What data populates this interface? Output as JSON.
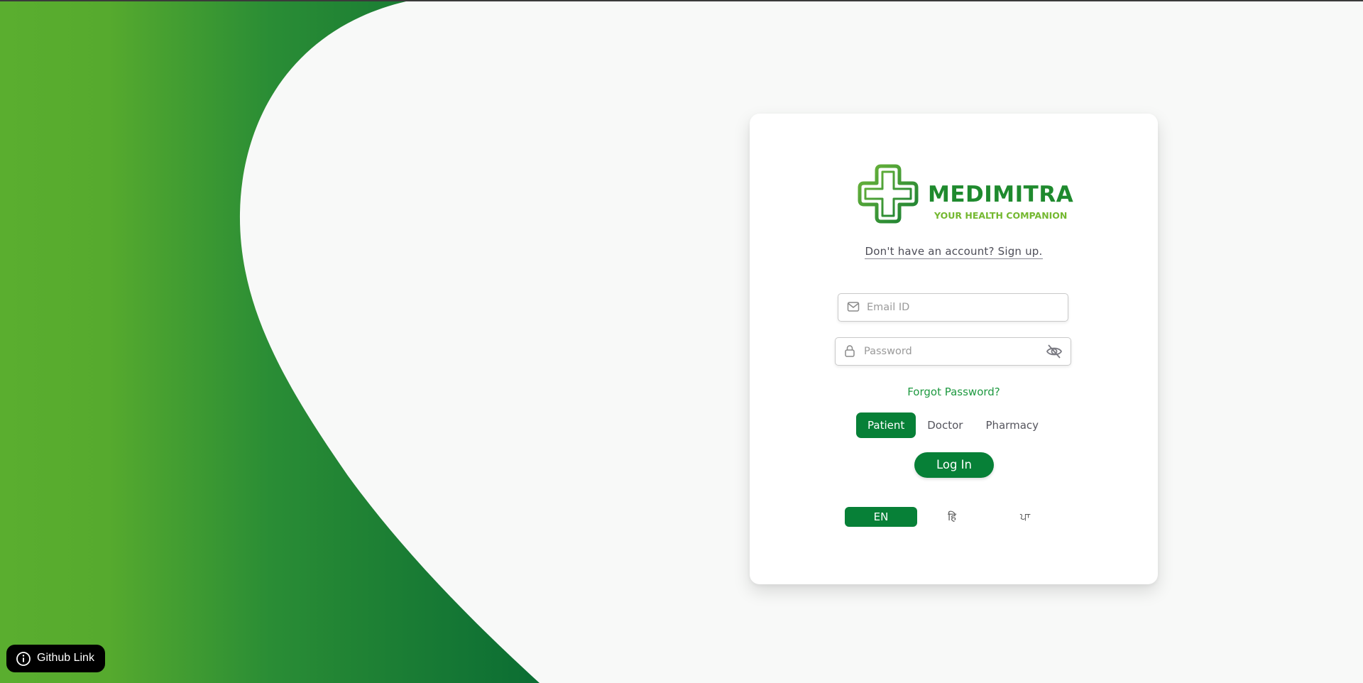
{
  "brand": {
    "name": "MEDIMITRA",
    "tagline": "YOUR HEALTH COMPANION",
    "colors": {
      "primary_green": "#078037",
      "logo_green": "#1f8a2e",
      "light_green": "#74b830",
      "link_green": "#1e9940"
    }
  },
  "auth": {
    "signup_link": "Don't have an account? Sign up.",
    "email_placeholder": "Email ID",
    "password_placeholder": "Password",
    "forgot_password": "Forgot Password?",
    "login_button": "Log In",
    "icons": {
      "email": "mail-icon",
      "password": "lock-icon",
      "toggle_visibility": "eye-off-icon"
    }
  },
  "roles": {
    "selected": "Patient",
    "items": [
      "Patient",
      "Doctor",
      "Pharmacy"
    ]
  },
  "languages": {
    "selected": "EN",
    "items": [
      "EN",
      "हि",
      "ਪਾ"
    ]
  },
  "footer": {
    "github_label": "Github Link",
    "icon": "info-icon"
  }
}
